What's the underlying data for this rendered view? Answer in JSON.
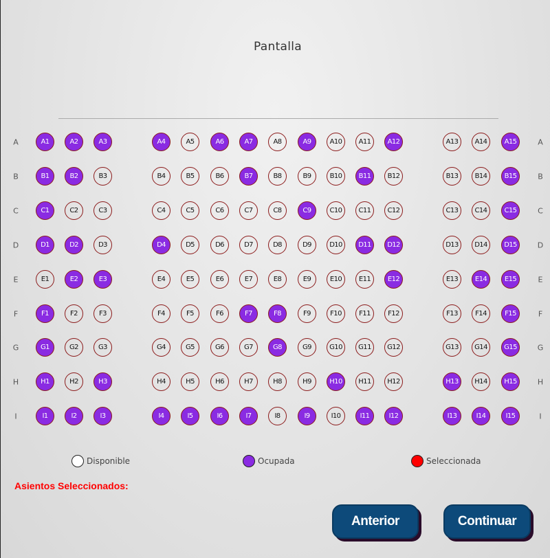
{
  "screen": {
    "title": "Pantalla"
  },
  "rows": [
    {
      "label": "A",
      "seats": [
        {
          "id": "A1",
          "occupied": true
        },
        {
          "id": "A2",
          "occupied": true
        },
        {
          "id": "A3",
          "occupied": true
        },
        {
          "id": "A4",
          "occupied": true
        },
        {
          "id": "A5",
          "occupied": false
        },
        {
          "id": "A6",
          "occupied": true
        },
        {
          "id": "A7",
          "occupied": true
        },
        {
          "id": "A8",
          "occupied": false
        },
        {
          "id": "A9",
          "occupied": true
        },
        {
          "id": "A10",
          "occupied": false
        },
        {
          "id": "A11",
          "occupied": false
        },
        {
          "id": "A12",
          "occupied": true
        },
        {
          "id": "A13",
          "occupied": false
        },
        {
          "id": "A14",
          "occupied": false
        },
        {
          "id": "A15",
          "occupied": true
        }
      ]
    },
    {
      "label": "B",
      "seats": [
        {
          "id": "B1",
          "occupied": true
        },
        {
          "id": "B2",
          "occupied": true
        },
        {
          "id": "B3",
          "occupied": false
        },
        {
          "id": "B4",
          "occupied": false
        },
        {
          "id": "B5",
          "occupied": false
        },
        {
          "id": "B6",
          "occupied": false
        },
        {
          "id": "B7",
          "occupied": true
        },
        {
          "id": "B8",
          "occupied": false
        },
        {
          "id": "B9",
          "occupied": false
        },
        {
          "id": "B10",
          "occupied": false
        },
        {
          "id": "B11",
          "occupied": true
        },
        {
          "id": "B12",
          "occupied": false
        },
        {
          "id": "B13",
          "occupied": false
        },
        {
          "id": "B14",
          "occupied": false
        },
        {
          "id": "B15",
          "occupied": true
        }
      ]
    },
    {
      "label": "C",
      "seats": [
        {
          "id": "C1",
          "occupied": true
        },
        {
          "id": "C2",
          "occupied": false
        },
        {
          "id": "C3",
          "occupied": false
        },
        {
          "id": "C4",
          "occupied": false
        },
        {
          "id": "C5",
          "occupied": false
        },
        {
          "id": "C6",
          "occupied": false
        },
        {
          "id": "C7",
          "occupied": false
        },
        {
          "id": "C8",
          "occupied": false
        },
        {
          "id": "C9",
          "occupied": true
        },
        {
          "id": "C10",
          "occupied": false
        },
        {
          "id": "C11",
          "occupied": false
        },
        {
          "id": "C12",
          "occupied": false
        },
        {
          "id": "C13",
          "occupied": false
        },
        {
          "id": "C14",
          "occupied": false
        },
        {
          "id": "C15",
          "occupied": true
        }
      ]
    },
    {
      "label": "D",
      "seats": [
        {
          "id": "D1",
          "occupied": true
        },
        {
          "id": "D2",
          "occupied": true
        },
        {
          "id": "D3",
          "occupied": false
        },
        {
          "id": "D4",
          "occupied": true
        },
        {
          "id": "D5",
          "occupied": false
        },
        {
          "id": "D6",
          "occupied": false
        },
        {
          "id": "D7",
          "occupied": false
        },
        {
          "id": "D8",
          "occupied": false
        },
        {
          "id": "D9",
          "occupied": false
        },
        {
          "id": "D10",
          "occupied": false
        },
        {
          "id": "D11",
          "occupied": true
        },
        {
          "id": "D12",
          "occupied": true
        },
        {
          "id": "D13",
          "occupied": false
        },
        {
          "id": "D14",
          "occupied": false
        },
        {
          "id": "D15",
          "occupied": true
        }
      ]
    },
    {
      "label": "E",
      "seats": [
        {
          "id": "E1",
          "occupied": false
        },
        {
          "id": "E2",
          "occupied": true
        },
        {
          "id": "E3",
          "occupied": true
        },
        {
          "id": "E4",
          "occupied": false
        },
        {
          "id": "E5",
          "occupied": false
        },
        {
          "id": "E6",
          "occupied": false
        },
        {
          "id": "E7",
          "occupied": false
        },
        {
          "id": "E8",
          "occupied": false
        },
        {
          "id": "E9",
          "occupied": false
        },
        {
          "id": "E10",
          "occupied": false
        },
        {
          "id": "E11",
          "occupied": false
        },
        {
          "id": "E12",
          "occupied": true
        },
        {
          "id": "E13",
          "occupied": false
        },
        {
          "id": "E14",
          "occupied": true
        },
        {
          "id": "E15",
          "occupied": true
        }
      ]
    },
    {
      "label": "F",
      "seats": [
        {
          "id": "F1",
          "occupied": true
        },
        {
          "id": "F2",
          "occupied": false
        },
        {
          "id": "F3",
          "occupied": false
        },
        {
          "id": "F4",
          "occupied": false
        },
        {
          "id": "F5",
          "occupied": false
        },
        {
          "id": "F6",
          "occupied": false
        },
        {
          "id": "F7",
          "occupied": true
        },
        {
          "id": "F8",
          "occupied": true
        },
        {
          "id": "F9",
          "occupied": false
        },
        {
          "id": "F10",
          "occupied": false
        },
        {
          "id": "F11",
          "occupied": false
        },
        {
          "id": "F12",
          "occupied": false
        },
        {
          "id": "F13",
          "occupied": false
        },
        {
          "id": "F14",
          "occupied": false
        },
        {
          "id": "F15",
          "occupied": true
        }
      ]
    },
    {
      "label": "G",
      "seats": [
        {
          "id": "G1",
          "occupied": true
        },
        {
          "id": "G2",
          "occupied": false
        },
        {
          "id": "G3",
          "occupied": false
        },
        {
          "id": "G4",
          "occupied": false
        },
        {
          "id": "G5",
          "occupied": false
        },
        {
          "id": "G6",
          "occupied": false
        },
        {
          "id": "G7",
          "occupied": false
        },
        {
          "id": "G8",
          "occupied": true
        },
        {
          "id": "G9",
          "occupied": false
        },
        {
          "id": "G10",
          "occupied": false
        },
        {
          "id": "G11",
          "occupied": false
        },
        {
          "id": "G12",
          "occupied": false
        },
        {
          "id": "G13",
          "occupied": false
        },
        {
          "id": "G14",
          "occupied": false
        },
        {
          "id": "G15",
          "occupied": true
        }
      ]
    },
    {
      "label": "H",
      "seats": [
        {
          "id": "H1",
          "occupied": true
        },
        {
          "id": "H2",
          "occupied": false
        },
        {
          "id": "H3",
          "occupied": true
        },
        {
          "id": "H4",
          "occupied": false
        },
        {
          "id": "H5",
          "occupied": false
        },
        {
          "id": "H6",
          "occupied": false
        },
        {
          "id": "H7",
          "occupied": false
        },
        {
          "id": "H8",
          "occupied": false
        },
        {
          "id": "H9",
          "occupied": false
        },
        {
          "id": "H10",
          "occupied": true
        },
        {
          "id": "H11",
          "occupied": false
        },
        {
          "id": "H12",
          "occupied": false
        },
        {
          "id": "H13",
          "occupied": true
        },
        {
          "id": "H14",
          "occupied": false
        },
        {
          "id": "H15",
          "occupied": true
        }
      ]
    },
    {
      "label": "I",
      "seats": [
        {
          "id": "I1",
          "occupied": true
        },
        {
          "id": "I2",
          "occupied": true
        },
        {
          "id": "I3",
          "occupied": true
        },
        {
          "id": "I4",
          "occupied": true
        },
        {
          "id": "I5",
          "occupied": true
        },
        {
          "id": "I6",
          "occupied": true
        },
        {
          "id": "I7",
          "occupied": true
        },
        {
          "id": "I8",
          "occupied": false
        },
        {
          "id": "I9",
          "occupied": true
        },
        {
          "id": "I10",
          "occupied": false
        },
        {
          "id": "I11",
          "occupied": true
        },
        {
          "id": "I12",
          "occupied": true
        },
        {
          "id": "I13",
          "occupied": true
        },
        {
          "id": "I14",
          "occupied": true
        },
        {
          "id": "I15",
          "occupied": true
        }
      ]
    }
  ],
  "legend": {
    "available": {
      "label": "Disponible",
      "color": "#ffffff"
    },
    "occupied": {
      "label": "Ocupada",
      "color": "#8a2be2"
    },
    "selected": {
      "label": "Seleccionada",
      "color": "#ff0000"
    }
  },
  "selected_seats": {
    "title": "Asientos Seleccionados:"
  },
  "buttons": {
    "previous": "Anterior",
    "continue": "Continuar"
  }
}
